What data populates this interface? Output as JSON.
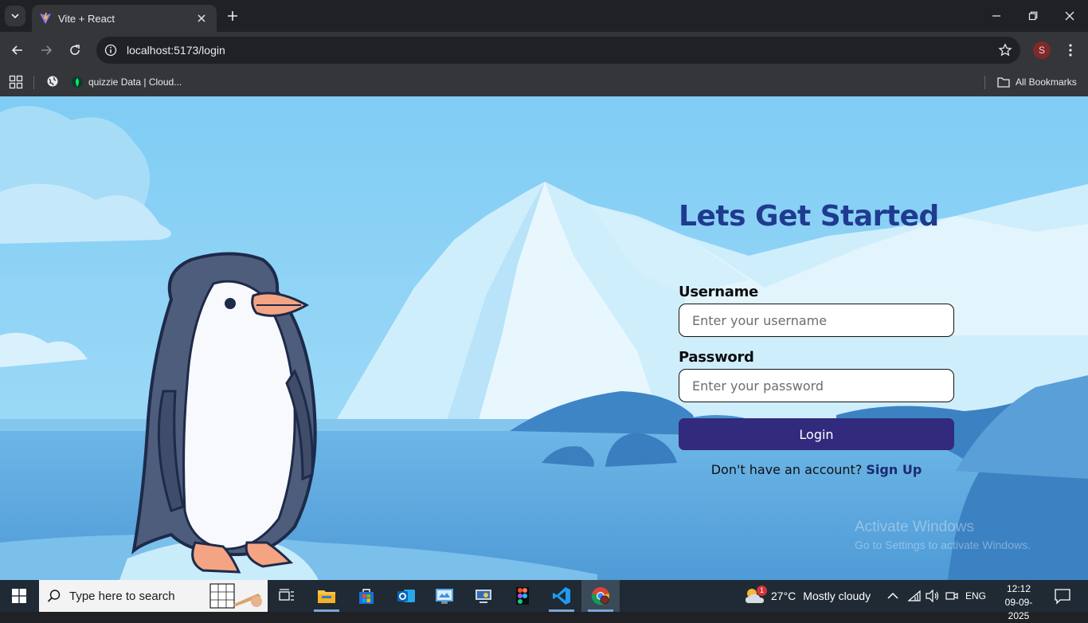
{
  "browser": {
    "tab_title": "Vite + React",
    "url": "localhost:5173/login",
    "profile_initial": "S",
    "bookmarks": [
      {
        "label": "quizzie Data | Cloud..."
      }
    ],
    "all_bookmarks_label": "All Bookmarks"
  },
  "login": {
    "title": "Lets Get Started",
    "username_label": "Username",
    "username_placeholder": "Enter your username",
    "password_label": "Password",
    "password_placeholder": "Enter your password",
    "login_button": "Login",
    "signup_prompt": "Don't have an account? ",
    "signup_link": "Sign Up"
  },
  "watermark": {
    "title": "Activate Windows",
    "subtitle": "Go to Settings to activate Windows."
  },
  "taskbar": {
    "search_placeholder": "Type here to search",
    "weather_badge": "1",
    "weather_temp": "27°C",
    "weather_desc": "Mostly cloudy",
    "language": "ENG",
    "time": "12:12",
    "date": "09-09-2025"
  },
  "colors": {
    "title": "#1f3b8f",
    "button": "#322a7d",
    "sky": "#8fd3f6",
    "water": "#5ea9df"
  }
}
